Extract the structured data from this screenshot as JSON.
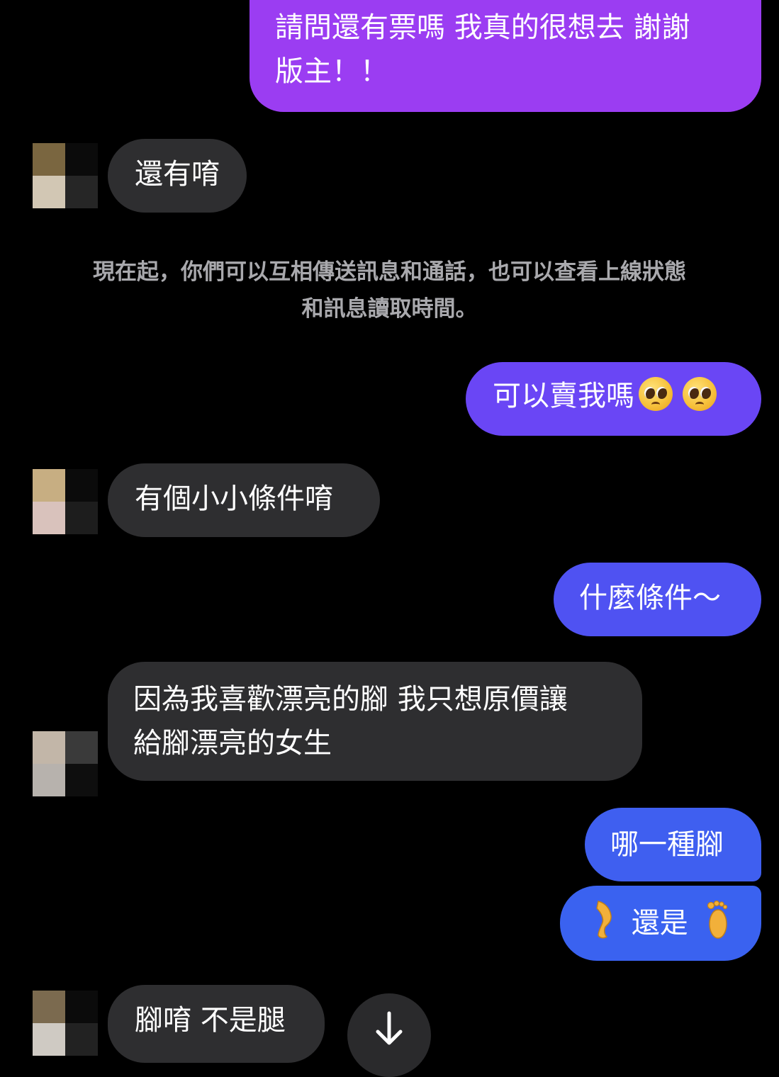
{
  "system_notice": {
    "line1": "現在起，你們可以互相傳送訊息和通話，也可以查看上線狀態",
    "line2": "和訊息讀取時間。"
  },
  "messages": {
    "m1": {
      "line1": "請問還有票嗎 我真的很想去 謝謝",
      "line2": "版主！！",
      "direction": "outgoing"
    },
    "m2": {
      "text": "還有唷",
      "direction": "incoming"
    },
    "m3": {
      "text": "可以賣我嗎",
      "emoji": [
        "pleading-face",
        "pleading-face"
      ],
      "direction": "outgoing"
    },
    "m4": {
      "text": "有個小小條件唷",
      "direction": "incoming"
    },
    "m5": {
      "text": "什麼條件～",
      "direction": "outgoing"
    },
    "m6": {
      "line1": "因為我喜歡漂亮的腳 我只想原價讓",
      "line2": "給腳漂亮的女生",
      "direction": "incoming"
    },
    "m7": {
      "text": "哪一種腳",
      "direction": "outgoing"
    },
    "m8": {
      "text": "還是",
      "emoji": [
        "leg",
        "foot"
      ],
      "direction": "outgoing"
    },
    "m9": {
      "text": "腳唷 不是腿",
      "direction": "incoming"
    }
  },
  "scroll_button": {
    "icon": "arrow-down-icon"
  },
  "colors": {
    "background": "#000000",
    "incoming_bubble": "#2e2e30",
    "outgoing_gradient_top": "#9b3df2",
    "outgoing_gradient_mid": "#6a46f5",
    "outgoing_gradient_bottom": "#3d5ff0",
    "system_text": "#a9a9ad"
  }
}
